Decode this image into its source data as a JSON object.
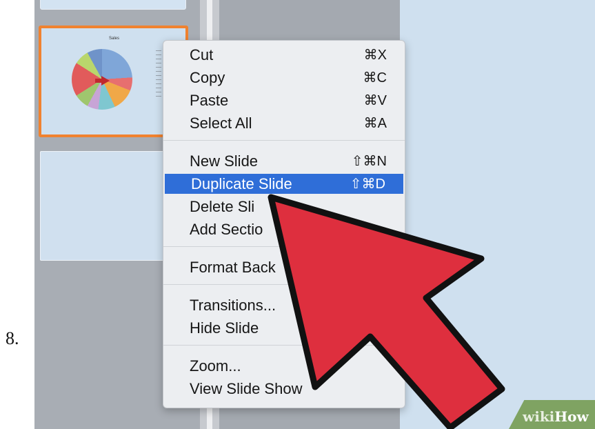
{
  "step": {
    "number": "8."
  },
  "thumbnails": {
    "selected": {
      "border_color": "#f0822f"
    }
  },
  "context_menu": {
    "groups": [
      [
        {
          "label": "Cut",
          "shortcut": "⌘X"
        },
        {
          "label": "Copy",
          "shortcut": "⌘C"
        },
        {
          "label": "Paste",
          "shortcut": "⌘V"
        },
        {
          "label": "Select All",
          "shortcut": "⌘A"
        }
      ],
      [
        {
          "label": "New Slide",
          "shortcut": "⇧⌘N"
        },
        {
          "label": "Duplicate Slide",
          "shortcut": "⇧⌘D",
          "highlighted": true
        },
        {
          "label": "Delete Sli",
          "shortcut": ""
        },
        {
          "label": "Add Sectio",
          "shortcut": ""
        }
      ],
      [
        {
          "label": "Format Back",
          "shortcut": ""
        }
      ],
      [
        {
          "label": "Transitions...",
          "shortcut": ""
        },
        {
          "label": "Hide Slide",
          "shortcut": ""
        }
      ],
      [
        {
          "label": "Zoom...",
          "shortcut": ""
        },
        {
          "label": "View Slide Show",
          "shortcut": ""
        }
      ]
    ],
    "highlight_color": "#2f6ed8"
  },
  "pointer": {
    "icon": "arrow-cursor-icon",
    "color": "#de2f3e"
  },
  "watermark": {
    "part1": "wiki",
    "part2": "How"
  }
}
